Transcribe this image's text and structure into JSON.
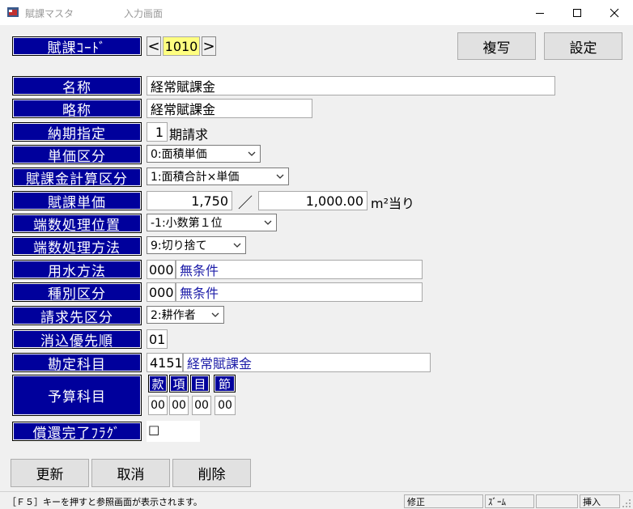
{
  "window": {
    "title": "賦課マスタ",
    "subtitle": "入力画面",
    "icon": "app-icon"
  },
  "fuka_code": {
    "label": "賦課ｺｰﾄﾞ",
    "prev": "<",
    "value": "1010",
    "next": ">"
  },
  "toolbar": {
    "copy_label": "複写",
    "settings_label": "設定"
  },
  "fields": {
    "name": {
      "label": "名称",
      "value": "経常賦課金"
    },
    "short_name": {
      "label": "略称",
      "value": "経常賦課金"
    },
    "due_period": {
      "label": "納期指定",
      "value": "1",
      "suffix": "期請求"
    },
    "unit_price_class": {
      "label": "単価区分",
      "value": "0:面積単価"
    },
    "calc_class": {
      "label": "賦課金計算区分",
      "value": "1:面積合計×単価"
    },
    "unit_price": {
      "label": "賦課単価",
      "value": "1,750",
      "separator": "／",
      "per": "1,000.00",
      "unit": "m²当り"
    },
    "rounding_position": {
      "label": "端数処理位置",
      "value": "-1:小数第１位"
    },
    "rounding_method": {
      "label": "端数処理方法",
      "value": "9:切り捨て"
    },
    "water_method": {
      "label": "用水方法",
      "code": "000",
      "name": "無条件"
    },
    "type_class": {
      "label": "種別区分",
      "code": "000",
      "name": "無条件"
    },
    "billing_target": {
      "label": "請求先区分",
      "value": "2:耕作者"
    },
    "offset_priority": {
      "label": "消込優先順",
      "value": "01"
    },
    "account": {
      "label": "勘定科目",
      "code": "4151",
      "name": "経常賦課金"
    },
    "budget": {
      "label": "予算科目",
      "headers": [
        "款",
        "項",
        "目",
        "節"
      ],
      "values": [
        "00",
        "00",
        "00",
        "00"
      ]
    },
    "repaid_flag": {
      "label": "償還完了ﾌﾗｸﾞ",
      "value": "□"
    }
  },
  "actions": {
    "update_label": "更新",
    "cancel_label": "取消",
    "delete_label": "削除"
  },
  "statusbar": {
    "hint": "［Ｆ５］キーを押すと参照画面が表示されます。",
    "mode": "修正",
    "zoom": "ｽﾞｰﾑ",
    "insert": "挿入"
  }
}
